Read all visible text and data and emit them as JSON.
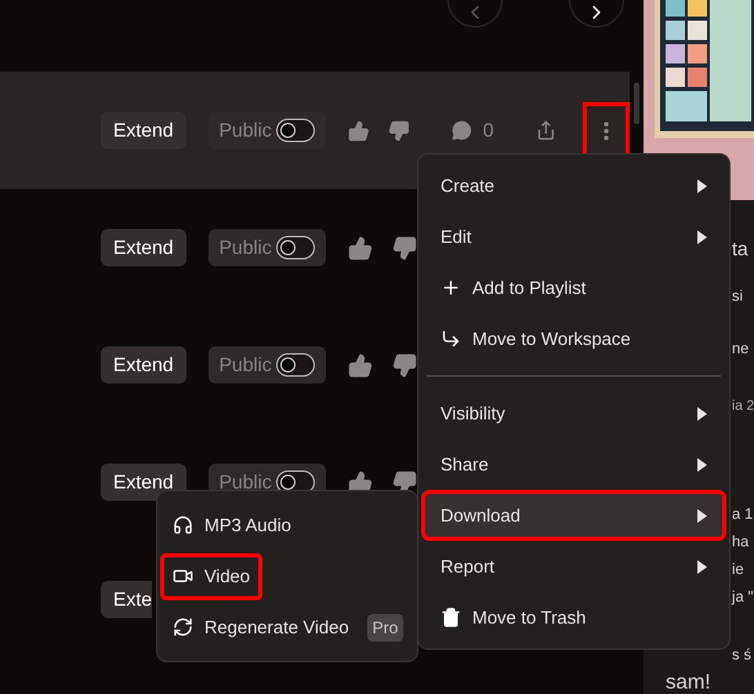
{
  "rows": [
    {
      "kind": "full",
      "extend": "Extend",
      "visibility": "Public",
      "public": false,
      "highlighted": true,
      "comments": "0",
      "more_annotated": true
    },
    {
      "kind": "partial",
      "extend": "Extend",
      "visibility": "Public",
      "public": false,
      "highlighted": false
    },
    {
      "kind": "partial",
      "extend": "Extend",
      "visibility": "Public",
      "public": false,
      "highlighted": false
    },
    {
      "kind": "partial",
      "extend": "Extend",
      "visibility": "Public",
      "public": false,
      "highlighted": false
    },
    {
      "kind": "stub",
      "extend": "Exte",
      "highlighted": false
    }
  ],
  "side_texts": [
    "ta",
    "si",
    "ne",
    "ia 2",
    "a 1",
    "ha",
    "ie",
    "ja \"",
    "s ś",
    "sam!"
  ],
  "menu": [
    {
      "kind": "submenu",
      "label": "Create",
      "selected": false,
      "annotated": false
    },
    {
      "kind": "submenu",
      "label": "Edit",
      "selected": false,
      "annotated": false
    },
    {
      "kind": "action",
      "label": "Add to Playlist",
      "selected": false,
      "annotated": false
    },
    {
      "kind": "action",
      "label": "Move to Workspace",
      "selected": false,
      "annotated": false
    },
    {
      "kind": "divider"
    },
    {
      "kind": "submenu",
      "label": "Visibility",
      "selected": false,
      "annotated": false
    },
    {
      "kind": "submenu",
      "label": "Share",
      "selected": false,
      "annotated": false
    },
    {
      "kind": "submenu",
      "label": "Download",
      "selected": true,
      "annotated": true
    },
    {
      "kind": "submenu",
      "label": "Report",
      "selected": false,
      "annotated": false
    },
    {
      "kind": "action",
      "label": "Move to Trash",
      "selected": false,
      "annotated": false
    }
  ],
  "download_menu": [
    {
      "label": "MP3 Audio",
      "selected": false,
      "annotated": false
    },
    {
      "label": "Video",
      "selected": false,
      "annotated": true
    },
    {
      "label": "Regenerate Video",
      "selected": false,
      "annotated": false,
      "badge": "Pro"
    }
  ]
}
